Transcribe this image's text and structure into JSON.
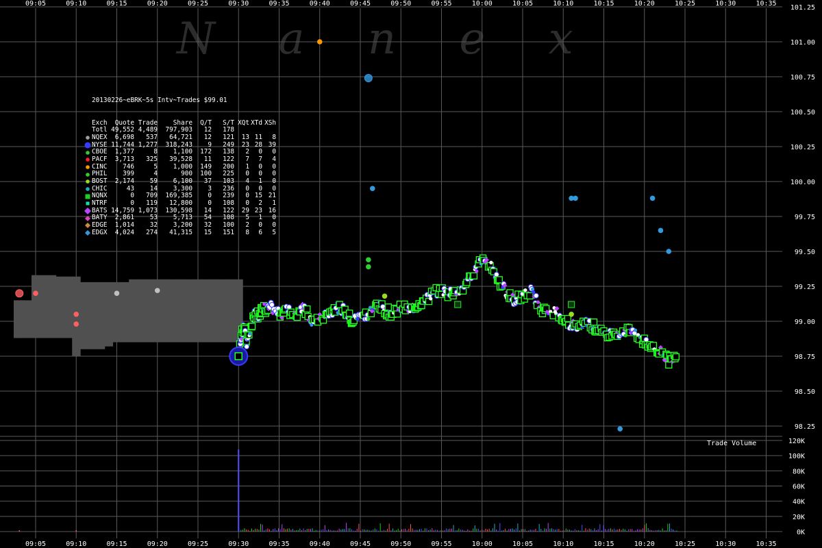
{
  "watermark": "N a n e x",
  "chart_data": {
    "type": "scatter",
    "title": "20130226~eBRK~5s Intv~Trades $99.01",
    "x_ticks": [
      "09:05",
      "09:10",
      "09:15",
      "09:20",
      "09:25",
      "09:30",
      "09:35",
      "09:40",
      "09:45",
      "09:50",
      "09:55",
      "10:00",
      "10:05",
      "10:10",
      "10:15",
      "10:20",
      "10:25",
      "10:30",
      "10:35"
    ],
    "x_range": [
      "09:02",
      "10:37"
    ],
    "y_ticks": [
      "101.25",
      "101.00",
      "100.75",
      "100.50",
      "100.25",
      "100.00",
      "99.75",
      "99.50",
      "99.25",
      "99.00",
      "98.75",
      "98.50",
      "98.25"
    ],
    "y_range": [
      98.25,
      101.25
    ],
    "volume_label": "Trade Volume",
    "volume_ticks": [
      "120K",
      "100K",
      "80K",
      "60K",
      "40K",
      "20K",
      "0K"
    ],
    "volume_range": [
      0,
      120000
    ],
    "grid": true,
    "legend_placement": "top-left",
    "legend": {
      "header": [
        "Exch",
        "Quote",
        "Trade",
        "Share",
        "Q/T",
        "S/T",
        "XQt",
        "XTd",
        "XSh"
      ],
      "rows": [
        {
          "exch": "Totl",
          "quote": "49,552",
          "trade": "4,489",
          "share": "797,903",
          "qt": "12",
          "st": "178",
          "xqt": "",
          "xtd": "",
          "xsh": "",
          "color": "",
          "marker": "none"
        },
        {
          "exch": "NQEX",
          "quote": "6,698",
          "trade": "537",
          "share": "64,721",
          "qt": "12",
          "st": "121",
          "xqt": "13",
          "xtd": "11",
          "xsh": "8",
          "color": "#a0a0a0",
          "marker": "circle"
        },
        {
          "exch": "NYSE",
          "quote": "11,744",
          "trade": "1,277",
          "share": "318,243",
          "qt": "9",
          "st": "249",
          "xqt": "23",
          "xtd": "28",
          "xsh": "39",
          "color": "#3a3aff",
          "marker": "circle-lg"
        },
        {
          "exch": "CBOE",
          "quote": "1,377",
          "trade": "8",
          "share": "1,100",
          "qt": "172",
          "st": "138",
          "xqt": "2",
          "xtd": "0",
          "xsh": "0",
          "color": "#33cc33",
          "marker": "circle"
        },
        {
          "exch": "PACF",
          "quote": "3,713",
          "trade": "325",
          "share": "39,528",
          "qt": "11",
          "st": "122",
          "xqt": "7",
          "xtd": "7",
          "xsh": "4",
          "color": "#ff2020",
          "marker": "circle"
        },
        {
          "exch": "CINC",
          "quote": "746",
          "trade": "5",
          "share": "1,000",
          "qt": "149",
          "st": "200",
          "xqt": "1",
          "xtd": "0",
          "xsh": "0",
          "color": "#ff9900",
          "marker": "circle"
        },
        {
          "exch": "PHIL",
          "quote": "399",
          "trade": "4",
          "share": "900",
          "qt": "100",
          "st": "225",
          "xqt": "0",
          "xtd": "0",
          "xsh": "0",
          "color": "#33cc33",
          "marker": "circle"
        },
        {
          "exch": "BOST",
          "quote": "2,174",
          "trade": "59",
          "share": "6,100",
          "qt": "37",
          "st": "103",
          "xqt": "4",
          "xtd": "1",
          "xsh": "0",
          "color": "#99dd22",
          "marker": "circle"
        },
        {
          "exch": "CHIC",
          "quote": "43",
          "trade": "14",
          "share": "3,300",
          "qt": "3",
          "st": "236",
          "xqt": "0",
          "xtd": "0",
          "xsh": "0",
          "color": "#22a8c8",
          "marker": "circle"
        },
        {
          "exch": "NQNX",
          "quote": "0",
          "trade": "709",
          "share": "169,385",
          "qt": "0",
          "st": "239",
          "xqt": "0",
          "xtd": "15",
          "xsh": "21",
          "color": "#22cc22",
          "marker": "square"
        },
        {
          "exch": "NTRF",
          "quote": "0",
          "trade": "119",
          "share": "12,800",
          "qt": "0",
          "st": "108",
          "xqt": "0",
          "xtd": "2",
          "xsh": "1",
          "color": "#22dd99",
          "marker": "square-sm"
        },
        {
          "exch": "BATS",
          "quote": "14,759",
          "trade": "1,073",
          "share": "130,598",
          "qt": "14",
          "st": "122",
          "xqt": "29",
          "xtd": "23",
          "xsh": "16",
          "color": "#bb44ff",
          "marker": "diamond-lg"
        },
        {
          "exch": "BATY",
          "quote": "2,861",
          "trade": "53",
          "share": "5,713",
          "qt": "54",
          "st": "108",
          "xqt": "5",
          "xtd": "1",
          "xsh": "0",
          "color": "#dd44bb",
          "marker": "diamond"
        },
        {
          "exch": "EDGE",
          "quote": "1,014",
          "trade": "32",
          "share": "3,200",
          "qt": "32",
          "st": "100",
          "xqt": "2",
          "xtd": "0",
          "xsh": "0",
          "color": "#cc8844",
          "marker": "diamond"
        },
        {
          "exch": "EDGX",
          "quote": "4,024",
          "trade": "274",
          "share": "41,315",
          "qt": "15",
          "st": "151",
          "xqt": "8",
          "xtd": "6",
          "xsh": "5",
          "color": "#3399dd",
          "marker": "diamond"
        }
      ]
    },
    "premarket_range": [
      {
        "t": "09:02",
        "lo": 98.88,
        "hi": 99.15
      },
      {
        "t": "09:03",
        "lo": 98.88,
        "hi": 99.15
      },
      {
        "t": "09:04",
        "lo": 98.88,
        "hi": 99.15
      },
      {
        "t": "09:05",
        "lo": 98.88,
        "hi": 99.33
      },
      {
        "t": "09:06",
        "lo": 98.88,
        "hi": 99.33
      },
      {
        "t": "09:07",
        "lo": 98.88,
        "hi": 99.33
      },
      {
        "t": "09:08",
        "lo": 98.88,
        "hi": 99.32
      },
      {
        "t": "09:09",
        "lo": 98.88,
        "hi": 99.32
      },
      {
        "t": "09:10",
        "lo": 98.75,
        "hi": 99.32
      },
      {
        "t": "09:11",
        "lo": 98.8,
        "hi": 99.28
      },
      {
        "t": "09:12",
        "lo": 98.8,
        "hi": 99.28
      },
      {
        "t": "09:13",
        "lo": 98.8,
        "hi": 99.28
      },
      {
        "t": "09:14",
        "lo": 98.82,
        "hi": 99.28
      },
      {
        "t": "09:15",
        "lo": 98.85,
        "hi": 99.28
      },
      {
        "t": "09:16",
        "lo": 98.85,
        "hi": 99.28
      },
      {
        "t": "09:17",
        "lo": 98.85,
        "hi": 99.3
      },
      {
        "t": "09:18",
        "lo": 98.85,
        "hi": 99.3
      },
      {
        "t": "09:19",
        "lo": 98.85,
        "hi": 99.3
      },
      {
        "t": "09:20",
        "lo": 98.85,
        "hi": 99.3
      },
      {
        "t": "09:21",
        "lo": 98.85,
        "hi": 99.3
      },
      {
        "t": "09:22",
        "lo": 98.85,
        "hi": 99.3
      },
      {
        "t": "09:23",
        "lo": 98.85,
        "hi": 99.3
      },
      {
        "t": "09:24",
        "lo": 98.85,
        "hi": 99.3
      },
      {
        "t": "09:25",
        "lo": 98.85,
        "hi": 99.3
      },
      {
        "t": "09:26",
        "lo": 98.85,
        "hi": 99.3
      },
      {
        "t": "09:27",
        "lo": 98.85,
        "hi": 99.3
      },
      {
        "t": "09:28",
        "lo": 98.85,
        "hi": 99.3
      },
      {
        "t": "09:29",
        "lo": 98.85,
        "hi": 99.3
      },
      {
        "t": "09:30",
        "lo": 98.85,
        "hi": 99.3
      }
    ],
    "main_path": [
      {
        "t": "09:30",
        "v": 98.8
      },
      {
        "t": "09:30:20",
        "v": 98.9
      },
      {
        "t": "09:30:40",
        "v": 98.95
      },
      {
        "t": "09:31",
        "v": 98.85
      },
      {
        "t": "09:31:30",
        "v": 98.95
      },
      {
        "t": "09:32",
        "v": 99.05
      },
      {
        "t": "09:32:30",
        "v": 99.05
      },
      {
        "t": "09:33",
        "v": 99.1
      },
      {
        "t": "09:33:30",
        "v": 99.08
      },
      {
        "t": "09:34",
        "v": 99.1
      },
      {
        "t": "09:35",
        "v": 99.05
      },
      {
        "t": "09:36",
        "v": 99.08
      },
      {
        "t": "09:37",
        "v": 99.05
      },
      {
        "t": "09:38",
        "v": 99.1
      },
      {
        "t": "09:39",
        "v": 99.0
      },
      {
        "t": "09:40",
        "v": 99.03
      },
      {
        "t": "09:41",
        "v": 99.05
      },
      {
        "t": "09:42",
        "v": 99.1
      },
      {
        "t": "09:43",
        "v": 99.08
      },
      {
        "t": "09:44",
        "v": 99.0
      },
      {
        "t": "09:45",
        "v": 99.05
      },
      {
        "t": "09:46",
        "v": 99.05
      },
      {
        "t": "09:47",
        "v": 99.12
      },
      {
        "t": "09:48",
        "v": 99.08
      },
      {
        "t": "09:49",
        "v": 99.05
      },
      {
        "t": "09:50",
        "v": 99.1
      },
      {
        "t": "09:51",
        "v": 99.08
      },
      {
        "t": "09:52",
        "v": 99.12
      },
      {
        "t": "09:53",
        "v": 99.15
      },
      {
        "t": "09:54",
        "v": 99.2
      },
      {
        "t": "09:55",
        "v": 99.22
      },
      {
        "t": "09:56",
        "v": 99.2
      },
      {
        "t": "09:57",
        "v": 99.22
      },
      {
        "t": "09:58",
        "v": 99.25
      },
      {
        "t": "09:59",
        "v": 99.35
      },
      {
        "t": "10:00",
        "v": 99.45
      },
      {
        "t": "10:01",
        "v": 99.4
      },
      {
        "t": "10:02",
        "v": 99.3
      },
      {
        "t": "10:03",
        "v": 99.2
      },
      {
        "t": "10:04",
        "v": 99.15
      },
      {
        "t": "10:05",
        "v": 99.18
      },
      {
        "t": "10:06",
        "v": 99.22
      },
      {
        "t": "10:07",
        "v": 99.12
      },
      {
        "t": "10:08",
        "v": 99.05
      },
      {
        "t": "10:09",
        "v": 99.08
      },
      {
        "t": "10:10",
        "v": 99.0
      },
      {
        "t": "10:11",
        "v": 98.98
      },
      {
        "t": "10:12",
        "v": 98.95
      },
      {
        "t": "10:13",
        "v": 99.0
      },
      {
        "t": "10:14",
        "v": 98.95
      },
      {
        "t": "10:15",
        "v": 98.9
      },
      {
        "t": "10:16",
        "v": 98.92
      },
      {
        "t": "10:17",
        "v": 98.88
      },
      {
        "t": "10:18",
        "v": 98.95
      },
      {
        "t": "10:19",
        "v": 98.9
      },
      {
        "t": "10:20",
        "v": 98.85
      },
      {
        "t": "10:21",
        "v": 98.82
      },
      {
        "t": "10:22",
        "v": 98.78
      },
      {
        "t": "10:23",
        "v": 98.72
      },
      {
        "t": "10:24",
        "v": 98.75
      }
    ],
    "outlier_points": [
      {
        "t": "09:03",
        "v": 99.2,
        "color": "#ff6060",
        "marker": "circle-lg"
      },
      {
        "t": "09:05",
        "v": 99.2,
        "color": "#ff6060",
        "marker": "circle"
      },
      {
        "t": "09:10",
        "v": 99.05,
        "color": "#ff6060",
        "marker": "circle"
      },
      {
        "t": "09:10",
        "v": 98.98,
        "color": "#ff6060",
        "marker": "circle"
      },
      {
        "t": "09:15",
        "v": 99.2,
        "color": "#c0c0c0",
        "marker": "circle"
      },
      {
        "t": "09:20",
        "v": 99.22,
        "color": "#c0c0c0",
        "marker": "circle"
      },
      {
        "t": "09:40",
        "v": 101.0,
        "color": "#ff9900",
        "marker": "circle"
      },
      {
        "t": "09:46",
        "v": 100.74,
        "color": "#3399dd",
        "marker": "circle-lg"
      },
      {
        "t": "09:46:30",
        "v": 99.95,
        "color": "#3399dd",
        "marker": "circle"
      },
      {
        "t": "09:46",
        "v": 99.44,
        "color": "#33cc33",
        "marker": "circle"
      },
      {
        "t": "09:46",
        "v": 99.39,
        "color": "#33cc33",
        "marker": "circle"
      },
      {
        "t": "10:11",
        "v": 99.88,
        "color": "#3399dd",
        "marker": "circle"
      },
      {
        "t": "10:11:30",
        "v": 99.88,
        "color": "#3399dd",
        "marker": "circle"
      },
      {
        "t": "10:21",
        "v": 99.88,
        "color": "#3399dd",
        "marker": "circle"
      },
      {
        "t": "10:22",
        "v": 99.65,
        "color": "#3399dd",
        "marker": "circle"
      },
      {
        "t": "10:23",
        "v": 99.5,
        "color": "#3399dd",
        "marker": "circle"
      },
      {
        "t": "10:17",
        "v": 98.23,
        "color": "#3399dd",
        "marker": "circle"
      },
      {
        "t": "09:30",
        "v": 98.75,
        "color": "#3a3aff",
        "marker": "circle-xl"
      },
      {
        "t": "10:11",
        "v": 99.12,
        "color": "#22cc22",
        "marker": "square"
      },
      {
        "t": "09:57",
        "v": 99.12,
        "color": "#22cc22",
        "marker": "square"
      },
      {
        "t": "10:11",
        "v": 99.05,
        "color": "#99dd22",
        "marker": "circle"
      },
      {
        "t": "09:48",
        "v": 99.18,
        "color": "#99dd22",
        "marker": "circle"
      }
    ],
    "volume_spike": {
      "t": "09:30",
      "v": 108000
    }
  }
}
